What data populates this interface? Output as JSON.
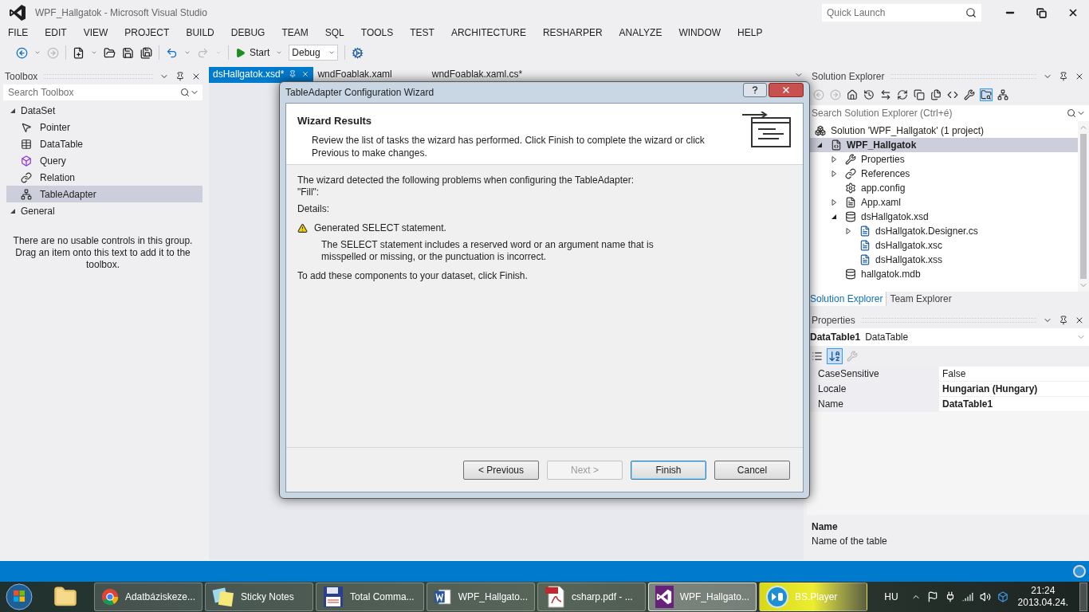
{
  "window": {
    "title": "WPF_Hallgatok - Microsoft Visual Studio"
  },
  "quick_launch": {
    "placeholder": "Quick Launch"
  },
  "menu": [
    "FILE",
    "EDIT",
    "VIEW",
    "PROJECT",
    "BUILD",
    "DEBUG",
    "TEAM",
    "SQL",
    "TOOLS",
    "TEST",
    "ARCHITECTURE",
    "RESHARPER",
    "ANALYZE",
    "WINDOW",
    "HELP"
  ],
  "toolbar": {
    "start_label": "Start",
    "configuration": "Debug"
  },
  "toolbox": {
    "title": "Toolbox",
    "search": {
      "placeholder": "Search Toolbox"
    },
    "groups": [
      {
        "label": "DataSet",
        "expanded": true,
        "items": [
          {
            "label": "Pointer",
            "kind": "pointer",
            "selected": false
          },
          {
            "label": "DataTable",
            "kind": "table",
            "selected": false
          },
          {
            "label": "Query",
            "kind": "query",
            "selected": false
          },
          {
            "label": "Relation",
            "kind": "relation",
            "selected": false
          },
          {
            "label": "TableAdapter",
            "kind": "adapter",
            "selected": true
          }
        ]
      },
      {
        "label": "General",
        "expanded": true,
        "message": "There are no usable controls in this group. Drag an item onto this text to add it to the toolbox."
      }
    ]
  },
  "document_tabs": [
    {
      "label": "dsHallgatok.xsd*",
      "selected": true
    },
    {
      "label": "wndFoablak.xaml",
      "selected": false
    },
    {
      "label": "wndFoablak.xaml.cs*",
      "selected": false
    }
  ],
  "dialog": {
    "title": "TableAdapter Configuration Wizard",
    "heading": "Wizard Results",
    "description": "Review the list of tasks the wizard has performed. Click Finish to complete the wizard or click Previous to make changes.",
    "intro": "The wizard detected the following problems when configuring the TableAdapter:",
    "method": "\"Fill\":",
    "details_label": "Details:",
    "warning": {
      "title": "Generated SELECT statement.",
      "text": "The SELECT statement includes a reserved word or an argument name that is misspelled or missing, or the punctuation is incorrect."
    },
    "footer": "To add these components to your dataset, click Finish.",
    "buttons": [
      {
        "label": "< Previous",
        "disabled": false
      },
      {
        "label": "Next >",
        "disabled": true
      },
      {
        "label": "Finish",
        "disabled": false,
        "default": true
      },
      {
        "label": "Cancel",
        "disabled": false
      }
    ]
  },
  "solution_explorer": {
    "title": "Solution Explorer",
    "search": {
      "placeholder": "Search Solution Explorer (Ctrl+é)"
    },
    "tree": [
      {
        "label": "Solution 'WPF_Hallgatok' (1 project)",
        "kind": "solution",
        "selected": false,
        "children": [
          {
            "label": "WPF_Hallgatok",
            "kind": "project",
            "selected": true,
            "expanded": true,
            "children": [
              {
                "label": "Properties",
                "kind": "properties",
                "selected": false,
                "expanded": false
              },
              {
                "label": "References",
                "kind": "references",
                "selected": false,
                "expanded": false
              },
              {
                "label": "app.config",
                "kind": "config",
                "selected": false
              },
              {
                "label": "App.xaml",
                "kind": "xaml",
                "selected": false,
                "expanded": false
              },
              {
                "label": "dsHallgatok.xsd",
                "kind": "dataset",
                "selected": false,
                "expanded": true,
                "children": [
                  {
                    "label": "dsHallgatok.Designer.cs",
                    "kind": "generated",
                    "selected": false,
                    "expanded": false
                  },
                  {
                    "label": "dsHallgatok.xsc",
                    "kind": "generated",
                    "selected": false
                  },
                  {
                    "label": "dsHallgatok.xss",
                    "kind": "generated",
                    "selected": false
                  }
                ]
              },
              {
                "label": "hallgatok.mdb",
                "kind": "database",
                "selected": false
              }
            ]
          }
        ]
      }
    ],
    "tabs": [
      {
        "label": "Solution Explorer",
        "selected": true
      },
      {
        "label": "Team Explorer",
        "selected": false
      }
    ]
  },
  "properties": {
    "title": "Properties",
    "object_name": "DataTable1",
    "object_type": "DataTable",
    "rows": [
      {
        "name": "CaseSensitive",
        "value": "False",
        "modified": false
      },
      {
        "name": "Locale",
        "value": "Hungarian (Hungary)",
        "modified": true
      },
      {
        "name": "Name",
        "value": "DataTable1",
        "modified": true
      }
    ],
    "description": {
      "title": "Name",
      "text": "Name of the table"
    }
  },
  "taskbar": {
    "buttons": [
      {
        "label": "Adatbáziskeze...",
        "kind": "chrome",
        "selected": false,
        "flashing": false
      },
      {
        "label": "Sticky Notes",
        "kind": "notes",
        "selected": false,
        "flashing": false
      },
      {
        "label": "Total Comma...",
        "kind": "floppy",
        "selected": false,
        "flashing": false
      },
      {
        "label": "WPF_Hallgato...",
        "kind": "word",
        "selected": false,
        "flashing": false
      },
      {
        "label": "csharp.pdf - ...",
        "kind": "pdf",
        "selected": false,
        "flashing": false
      },
      {
        "label": "WPF_Hallgato...",
        "kind": "vs",
        "selected": true,
        "flashing": false
      },
      {
        "label": "BS.Player",
        "kind": "player",
        "selected": false,
        "flashing": true
      }
    ],
    "language": "HU",
    "time": "21:24",
    "date": "2013.04.24."
  }
}
